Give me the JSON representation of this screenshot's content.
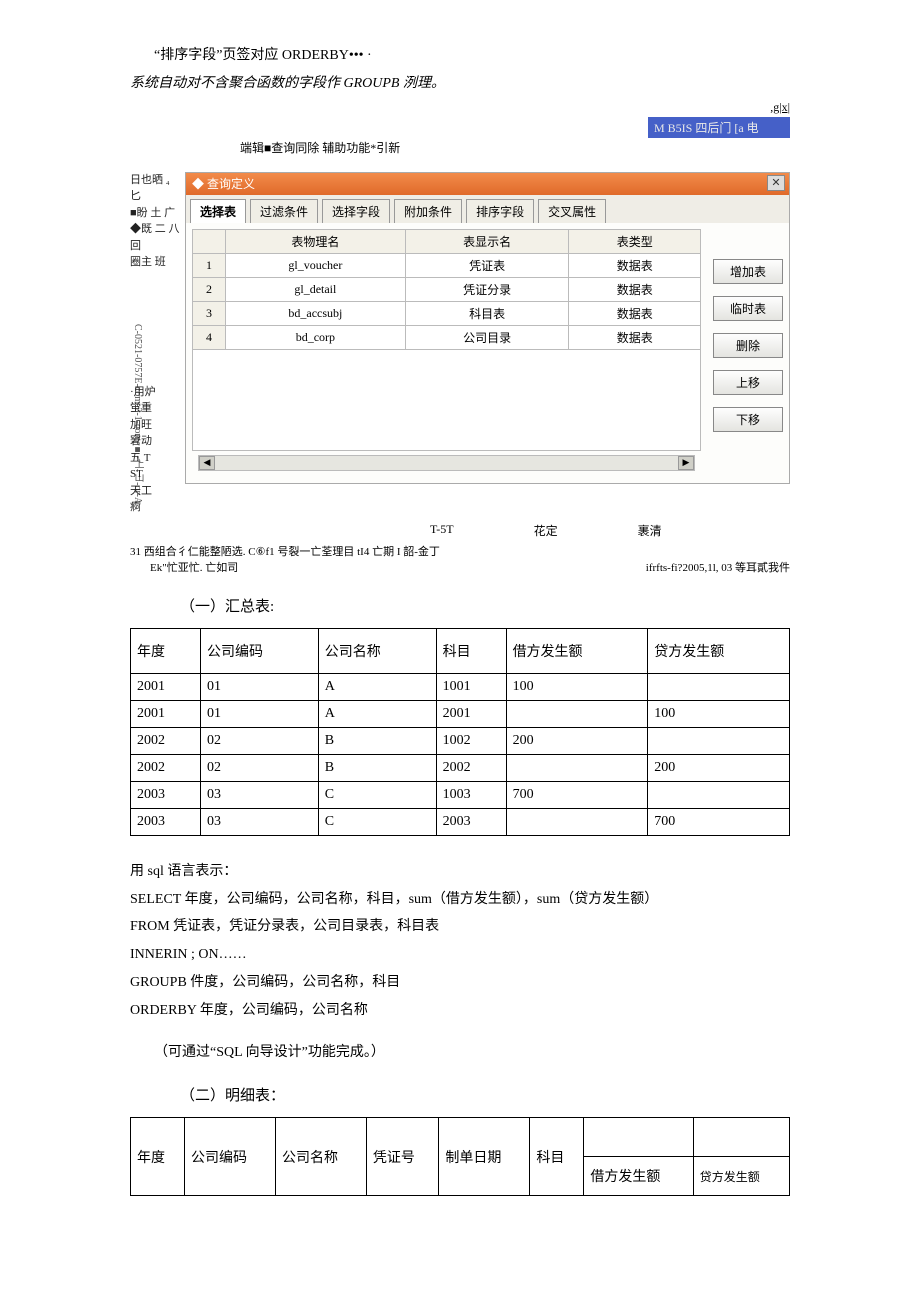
{
  "top_text_1": "“排序字段”页签对应 ORDERBY••• ·",
  "top_text_2": "系统自动对不含聚合函数的字段作 GROUPB 洌理。",
  "upper_right": ",g|x|",
  "bluebar": "M B5IS 四后门  [a 电",
  "toolbar": "端辑■查询同除 辅助功能*引新",
  "left_fragments": [
    "日也晒 ₄匕",
    "■盼  土 广",
    "◆既  二 八",
    "回",
    "圈主  班"
  ],
  "left_frag_2": [
    "·用炉",
    "蛍重",
    "加旺",
    "窘动",
    "五  T",
    "ST",
    "天工",
    "痾"
  ],
  "dialog_title": "◆ 查询定义",
  "tabs": [
    "选择表",
    "过滤条件",
    "选择字段",
    "附加条件",
    "排序字段",
    "交叉属性"
  ],
  "grid_headers": [
    "表物理名",
    "表显示名",
    "表类型"
  ],
  "grid_rows": [
    {
      "idx": "1",
      "phys": "gl_voucher",
      "disp": "凭证表",
      "type": "数据表"
    },
    {
      "idx": "2",
      "phys": "gl_detail",
      "disp": "凭证分录",
      "type": "数据表"
    },
    {
      "idx": "3",
      "phys": "bd_accsubj",
      "disp": "科目表",
      "type": "数据表"
    },
    {
      "idx": "4",
      "phys": "bd_corp",
      "disp": "公司目录",
      "type": "数据表"
    }
  ],
  "side_buttons": [
    "增加表",
    "临时表",
    "删除",
    "上移",
    "下移"
  ],
  "below_dlg": [
    "T-5T",
    "花定",
    "裹清"
  ],
  "footer_scrap": "31 西组合彳仁能整陋选. C⑥f1 号裂一亡荃理目 tI4 亡期 I 韶-金丁",
  "footer_left": "Ek\"忙亚忙. 亡如司",
  "footer_right": "ifrfts-fi?2005,1l, 03 等耳貳我件",
  "sec1_heading": "（一）汇总表:",
  "chart_data": {
    "type": "table",
    "title": "汇总表",
    "columns": [
      "年度",
      "公司编码",
      "公司名称",
      "科目",
      "借方发生额",
      "贷方发生额"
    ],
    "rows": [
      [
        "2001",
        "01",
        "A",
        "1001",
        "100",
        ""
      ],
      [
        "2001",
        "01",
        "A",
        "2001",
        "",
        "100"
      ],
      [
        "2002",
        "02",
        "B",
        "1002",
        "200",
        ""
      ],
      [
        "2002",
        "02",
        "B",
        "2002",
        "",
        "200"
      ],
      [
        "2003",
        "03",
        "C",
        "1003",
        "700",
        ""
      ],
      [
        "2003",
        "03",
        "C",
        "2003",
        "",
        "700"
      ]
    ]
  },
  "sql_intro": "用 sql 语言表示：",
  "sql_lines": [
    "SELECT 年度，公司编码，公司名称，科目，sum（借方发生额），sum（贷方发生额）",
    "FROM 凭证表，凭证分录表，公司目录表，科目表",
    "INNERIN ; ON……",
    "GROUPB 件度，公司编码，公司名称，科目",
    "ORDERBY 年度，公司编码，公司名称"
  ],
  "sql_note": "（可通过“SQL 向导设计”功能完成。）",
  "sec2_heading": "（二）明细表：",
  "detail_headers": [
    "年度",
    "公司编码",
    "公司名称",
    "凭证号",
    "制单日期",
    "科目",
    "",
    ""
  ],
  "detail_sub": [
    "借方发生额",
    "贷方发生额"
  ]
}
